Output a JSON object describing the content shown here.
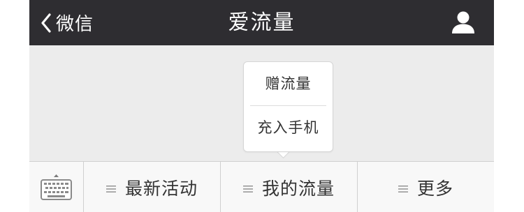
{
  "navbar": {
    "back_label": "微信",
    "title": "爱流量",
    "background": "#2e2d31"
  },
  "popup_menu": {
    "items": [
      {
        "label": "赠流量"
      },
      {
        "label": "充入手机"
      }
    ]
  },
  "bottom_menu": {
    "items": [
      {
        "label": "最新活动"
      },
      {
        "label": "我的流量"
      },
      {
        "label": "更多"
      }
    ]
  },
  "icons": {
    "back": "chevron-left-icon",
    "profile": "person-icon",
    "keyboard": "keyboard-icon",
    "menu": "menu-lines-icon"
  },
  "colors": {
    "page_background": "#ececec",
    "menubar_background": "#f8f8f8",
    "text": "#333333"
  }
}
